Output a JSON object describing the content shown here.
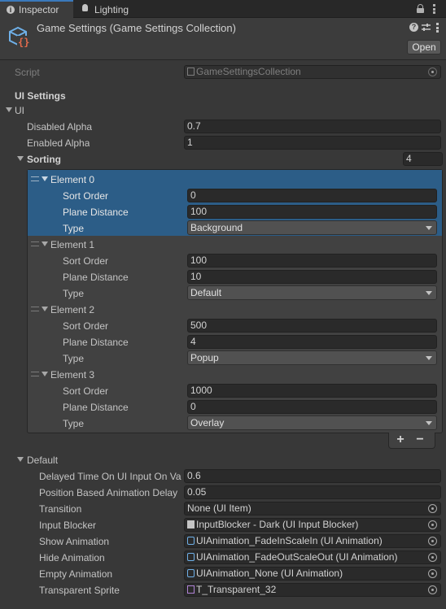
{
  "tabs": {
    "inspector": "Inspector",
    "lighting": "Lighting"
  },
  "header": {
    "title": "Game Settings (Game Settings Collection)",
    "open_button": "Open"
  },
  "script": {
    "label": "Script",
    "value": "GameSettingsCollection"
  },
  "section_title": "UI Settings",
  "ui": {
    "label": "UI",
    "disabled_alpha": {
      "label": "Disabled Alpha",
      "value": "0.7"
    },
    "enabled_alpha": {
      "label": "Enabled Alpha",
      "value": "1"
    },
    "sorting": {
      "label": "Sorting",
      "count": "4",
      "field_labels": {
        "sort_order": "Sort Order",
        "plane_distance": "Plane Distance",
        "type": "Type"
      },
      "elements": [
        {
          "name": "Element 0",
          "sort_order": "0",
          "plane_distance": "100",
          "type": "Background"
        },
        {
          "name": "Element 1",
          "sort_order": "100",
          "plane_distance": "10",
          "type": "Default"
        },
        {
          "name": "Element 2",
          "sort_order": "500",
          "plane_distance": "4",
          "type": "Popup"
        },
        {
          "name": "Element 3",
          "sort_order": "1000",
          "plane_distance": "0",
          "type": "Overlay"
        }
      ],
      "add_button": "+",
      "remove_button": "−"
    }
  },
  "default": {
    "label": "Default",
    "rows": [
      {
        "label": "Delayed Time On UI Input On Va",
        "value": "0.6"
      },
      {
        "label": "Position Based Animation Delay",
        "value": "0.05"
      },
      {
        "label": "Transition",
        "value": "None (UI Item)"
      },
      {
        "label": "Input Blocker",
        "value": "InputBlocker - Dark (UI Input Blocker)"
      },
      {
        "label": "Show Animation",
        "value": "UIAnimation_FadeInScaleIn (UI Animation)"
      },
      {
        "label": "Hide Animation",
        "value": "UIAnimation_FadeOutScaleOut (UI Animation)"
      },
      {
        "label": "Empty Animation",
        "value": "UIAnimation_None (UI Animation)"
      },
      {
        "label": "Transparent Sprite",
        "value": "T_Transparent_32"
      }
    ]
  },
  "colors": {
    "selection": "#2c5d87",
    "accent": "#3a79bb",
    "background": "#383838"
  }
}
